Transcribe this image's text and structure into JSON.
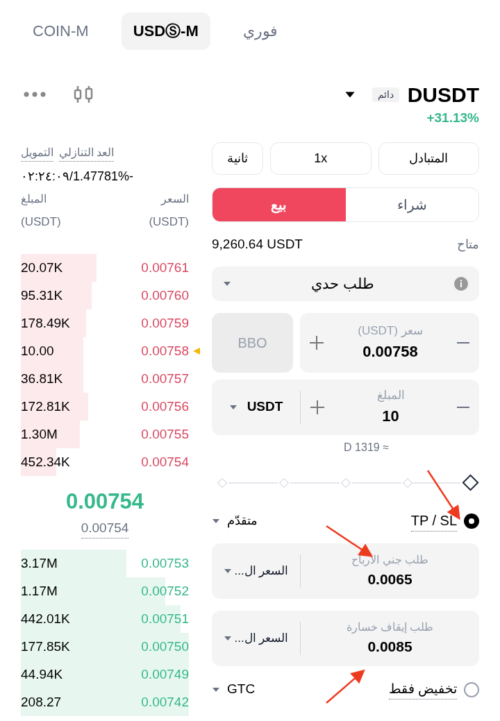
{
  "market_tabs": [
    {
      "label": "فوري",
      "selected": false
    },
    {
      "label": "USDⓈ-M",
      "selected": true
    },
    {
      "label": "COIN-M",
      "selected": false
    }
  ],
  "symbol": {
    "name": "DUSDT",
    "tag": "دائم",
    "change": "+31.13%"
  },
  "funding": {
    "funding_label": "التمويل",
    "countdown_label": "العد التنازلي",
    "value": "٠٢:٢٤:٠٩/1.47781%-"
  },
  "order_book": {
    "amount_header": "المبلغ",
    "amount_unit": "(USDT)",
    "price_header": "السعر",
    "price_unit": "(USDT)",
    "asks": [
      {
        "price": "0.00761",
        "amount": "20.07K",
        "selected": false
      },
      {
        "price": "0.00760",
        "amount": "95.31K",
        "selected": false
      },
      {
        "price": "0.00759",
        "amount": "178.49K",
        "selected": false
      },
      {
        "price": "0.00758",
        "amount": "10.00",
        "selected": true
      },
      {
        "price": "0.00757",
        "amount": "36.81K",
        "selected": false
      },
      {
        "price": "0.00756",
        "amount": "172.81K",
        "selected": false
      },
      {
        "price": "0.00755",
        "amount": "1.30M",
        "selected": false
      },
      {
        "price": "0.00754",
        "amount": "452.34K",
        "selected": false
      }
    ],
    "last_price": "0.00754",
    "mark_price": "0.00754",
    "bids": [
      {
        "price": "0.00753",
        "amount": "3.17M"
      },
      {
        "price": "0.00752",
        "amount": "1.17M"
      },
      {
        "price": "0.00751",
        "amount": "442.01K"
      },
      {
        "price": "0.00750",
        "amount": "177.85K"
      },
      {
        "price": "0.00749",
        "amount": "44.94K"
      },
      {
        "price": "0.00742",
        "amount": "208.27"
      }
    ]
  },
  "margin_buttons": [
    "المتبادل",
    "1x",
    "ثانية"
  ],
  "side_tabs": [
    {
      "label": "شراء",
      "selected": false
    },
    {
      "label": "بيع",
      "selected": true
    }
  ],
  "available": {
    "label": "متاح",
    "value": "9,260.64 USDT"
  },
  "order_type": {
    "value": "طلب حدي"
  },
  "price_field": {
    "label": "سعر (USDT)",
    "value": "0.00758",
    "bbo": "BBO",
    "bbo_disabled": true
  },
  "amount_field": {
    "label": "المبلغ",
    "value": "10",
    "unit": "USDT"
  },
  "estimate": "D 1319 ≈",
  "tpsl": {
    "label": "TP / SL",
    "checked": true,
    "advanced": "متقدّم"
  },
  "tp_field": {
    "label": "طلب جني الأرباح",
    "value": "0.0065",
    "trigger": "السعر ال..."
  },
  "sl_field": {
    "label": "طلب إيقاف خسارة",
    "value": "0.0085",
    "trigger": "السعر ال..."
  },
  "reduce_only": {
    "label": "تخفيض فقط",
    "checked": false
  },
  "time_in_force": "GTC"
}
